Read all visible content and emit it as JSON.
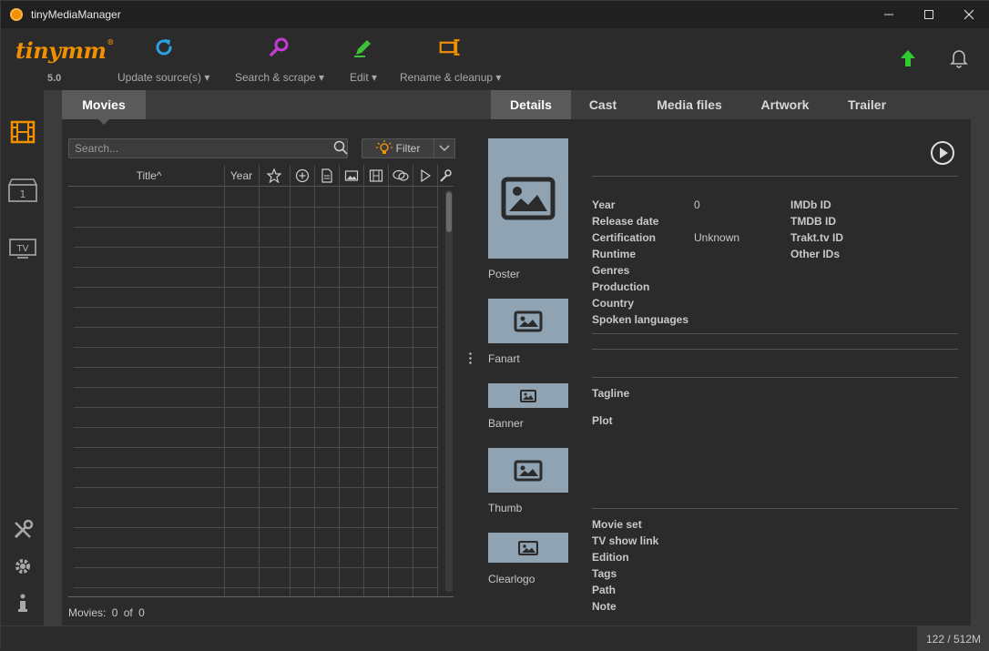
{
  "window": {
    "title": "tinyMediaManager"
  },
  "logo": {
    "text": "tinymm",
    "mark": "®",
    "version": "5.0"
  },
  "toolbar": {
    "update": "Update source(s)",
    "search": "Search & scrape",
    "edit": "Edit",
    "rename": "Rename & cleanup"
  },
  "movies_panel": {
    "tab": "Movies",
    "search_placeholder": "Search...",
    "filter_label": "Filter",
    "columns": {
      "title": "Title^",
      "year": "Year"
    },
    "count_label": "Movies:",
    "count_shown": "0",
    "count_of": "of",
    "count_total": "0"
  },
  "details": {
    "tabs": [
      "Details",
      "Cast",
      "Media files",
      "Artwork",
      "Trailer"
    ],
    "artwork": {
      "poster": "Poster",
      "fanart": "Fanart",
      "banner": "Banner",
      "thumb": "Thumb",
      "clearlogo": "Clearlogo"
    },
    "fields": {
      "year_label": "Year",
      "year_value": "0",
      "release_date": "Release date",
      "certification_label": "Certification",
      "certification_value": "Unknown",
      "runtime": "Runtime",
      "genres": "Genres",
      "production": "Production",
      "country": "Country",
      "spoken_languages": "Spoken languages",
      "imdb": "IMDb ID",
      "tmdb": "TMDB ID",
      "trakt": "Trakt.tv ID",
      "other_ids": "Other IDs",
      "tagline": "Tagline",
      "plot": "Plot",
      "movie_set": "Movie set",
      "tv_show_link": "TV show link",
      "edition": "Edition",
      "tags": "Tags",
      "path": "Path",
      "note": "Note"
    }
  },
  "status": {
    "memory": "122 / 512M"
  },
  "colors": {
    "accent": "#f19000",
    "update_green": "#2ecc2e",
    "image_placeholder": "#8fa3b3"
  }
}
